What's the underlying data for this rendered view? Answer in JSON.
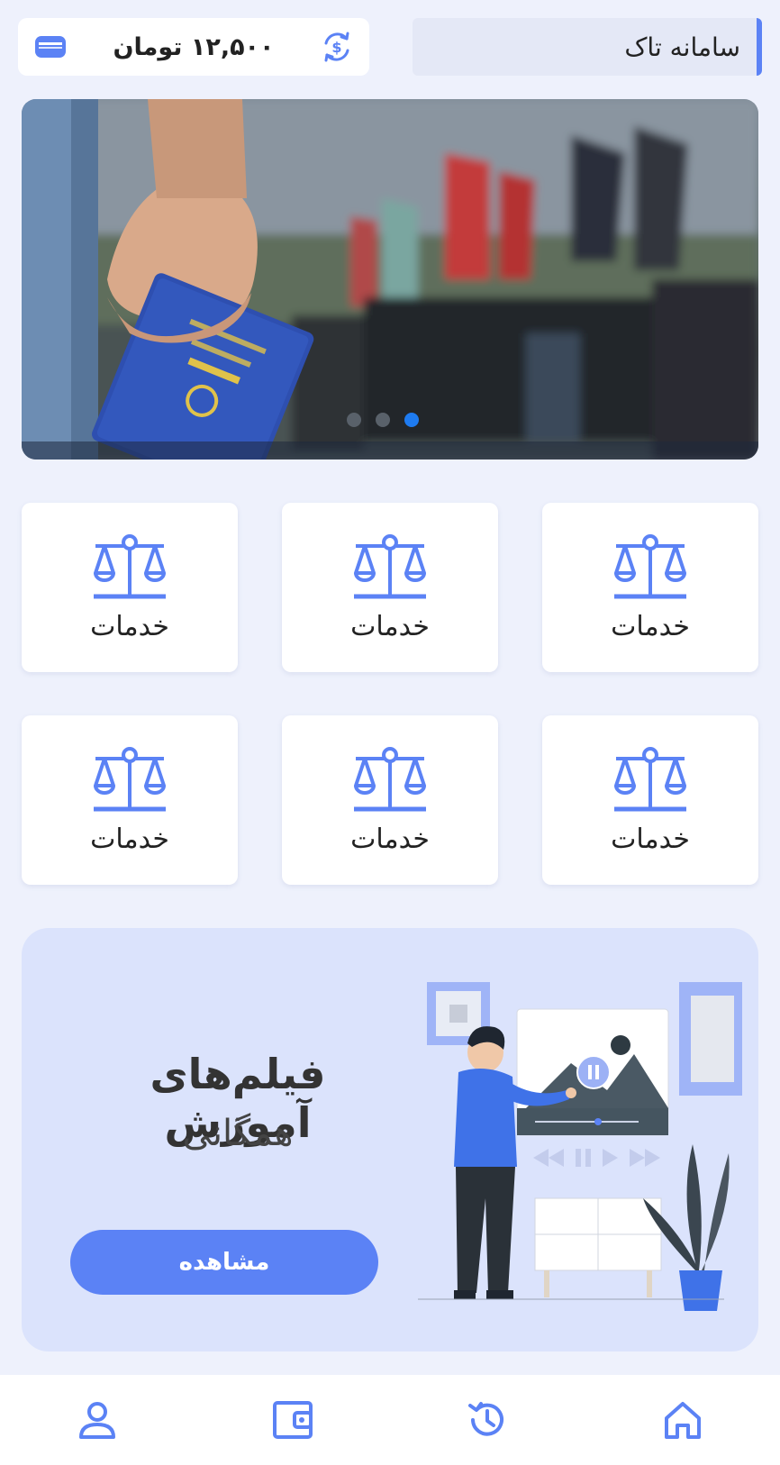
{
  "header": {
    "title": "سامانه تاک",
    "balance": "۱۲,۵۰۰ تومان",
    "refresh_icon": "currency-refresh-icon",
    "wallet_icon": "wallet-card-icon"
  },
  "banner": {
    "slide_count": 3,
    "active_slide": 3
  },
  "services": [
    {
      "label": "خدمات",
      "icon": "scale-icon"
    },
    {
      "label": "خدمات",
      "icon": "scale-icon"
    },
    {
      "label": "خدمات",
      "icon": "scale-icon"
    },
    {
      "label": "خدمات",
      "icon": "scale-icon"
    },
    {
      "label": "خدمات",
      "icon": "scale-icon"
    },
    {
      "label": "خدمات",
      "icon": "scale-icon"
    }
  ],
  "promo": {
    "title": "فیلم‌های آموزش",
    "subtitle": "همگانی",
    "button_label": "مشاهده"
  },
  "bottom_nav": [
    "home-icon",
    "history-icon",
    "wallet-icon",
    "profile-icon"
  ],
  "colors": {
    "accent": "#5b82f5",
    "background": "#eef1fc",
    "active_dot": "#1e7bf0"
  }
}
